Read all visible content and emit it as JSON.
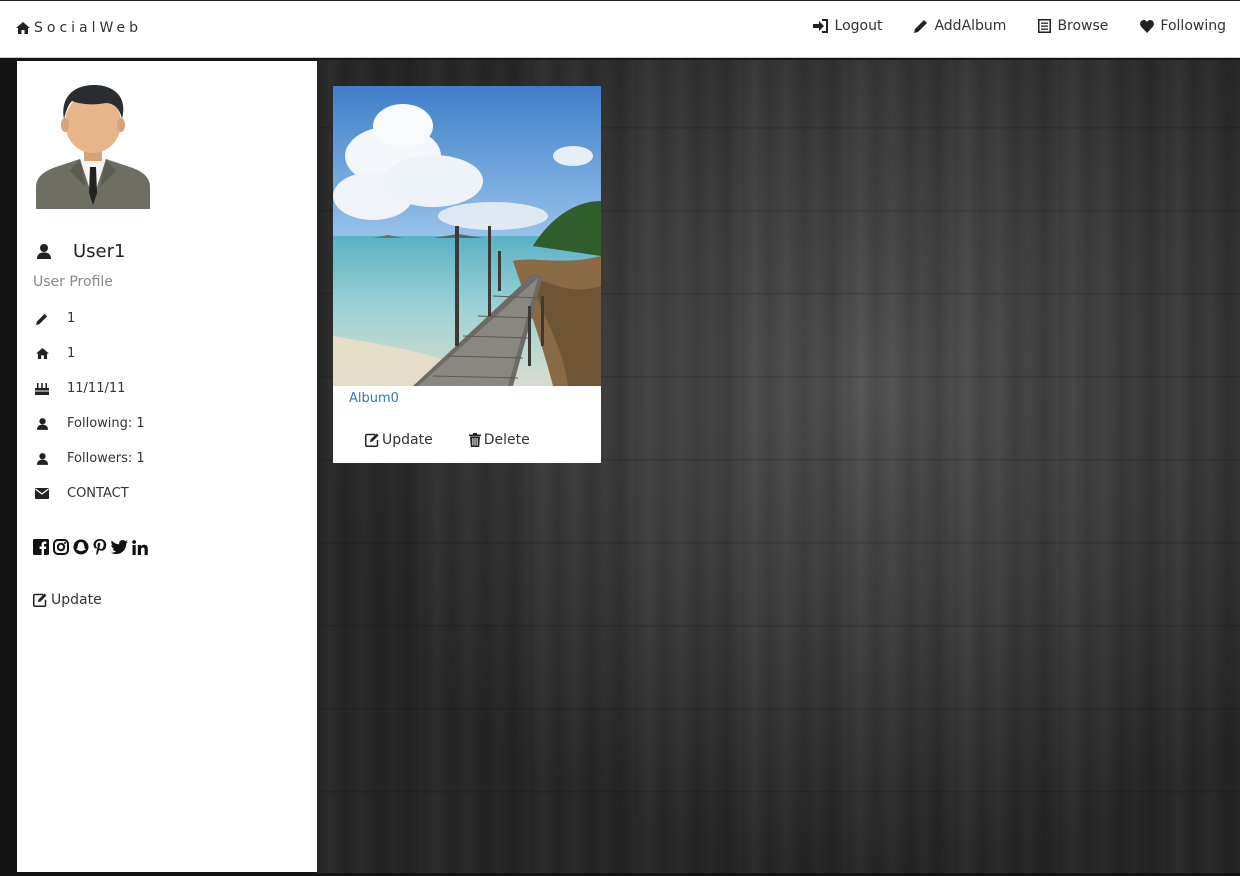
{
  "navbar": {
    "brand": "SocialWeb",
    "links": [
      "Logout",
      "AddAlbum",
      "Browse",
      "Following"
    ]
  },
  "profile": {
    "username": "User1",
    "subtitle": "User Profile",
    "info": [
      {
        "icon": "pencil-icon",
        "value": "1"
      },
      {
        "icon": "home-icon",
        "value": "1"
      },
      {
        "icon": "birthday-cake-icon",
        "value": "11/11/11"
      },
      {
        "icon": "user-icon",
        "value": "Following: 1"
      },
      {
        "icon": "user-icon",
        "value": "Followers: 1"
      },
      {
        "icon": "envelope-icon",
        "value": "CONTACT"
      }
    ],
    "socials": [
      "facebook-icon",
      "instagram-icon",
      "snapchat-icon",
      "pinterest-icon",
      "twitter-icon",
      "linkedin-icon"
    ],
    "update_label": "Update"
  },
  "albums": [
    {
      "title": "Album0",
      "update_label": "Update",
      "delete_label": "Delete"
    }
  ],
  "colors": {
    "link": "#337ab7",
    "background": "#3a3a3a",
    "panel": "#ffffff"
  }
}
